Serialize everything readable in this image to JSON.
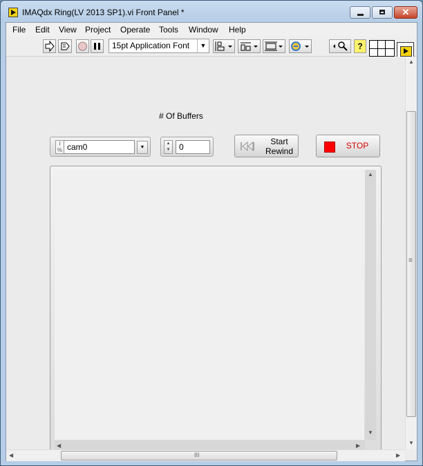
{
  "window": {
    "title": "IMAQdx Ring(LV 2013 SP1).vi Front Panel *",
    "close_label": "✕"
  },
  "menu": [
    "File",
    "Edit",
    "View",
    "Project",
    "Operate",
    "Tools",
    "Window",
    "Help"
  ],
  "toolbar": {
    "font_label": "15pt Application Font",
    "icons": [
      "run-arrow-icon",
      "run-continuously-icon",
      "abort-icon",
      "pause-icon",
      "align-objects-icon",
      "distribute-objects-icon",
      "resize-objects-icon",
      "reorder-icon",
      "search-icon",
      "context-help-icon"
    ]
  },
  "controls": {
    "camera": {
      "value": "cam0"
    },
    "buffers": {
      "label": "# Of Buffers",
      "value": "0"
    },
    "start_button": {
      "line1": "Start",
      "line2": "Rewind"
    },
    "stop_button": {
      "label": "STOP"
    }
  },
  "colors": {
    "stop_led": "#ff0000",
    "stop_text": "#d40000"
  },
  "scroll": {
    "h_grip": "III",
    "v_grip": "≡"
  }
}
